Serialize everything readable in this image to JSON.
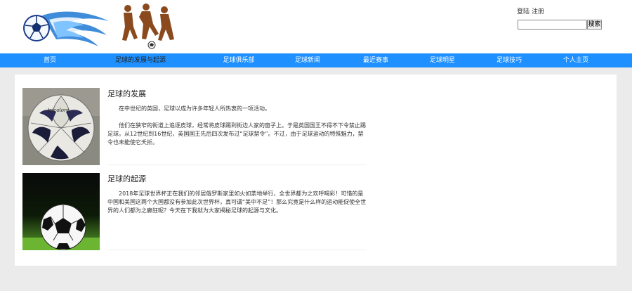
{
  "header": {
    "auth": {
      "login": "登陆",
      "register": "注册"
    },
    "search": {
      "placeholder": "",
      "button": "搜索"
    }
  },
  "nav": {
    "items": [
      {
        "label": "首页"
      },
      {
        "label": "足球的发展与起源"
      },
      {
        "label": "足球俱乐部"
      },
      {
        "label": "足球新闻"
      },
      {
        "label": "最近赛事"
      },
      {
        "label": "足球明星"
      },
      {
        "label": "足球技巧"
      },
      {
        "label": "个人主页"
      }
    ],
    "active_index": 1
  },
  "articles": [
    {
      "title": "足球的发展",
      "paragraphs": [
        "在中世纪的英国，足球以成为许多年轻人所热衷的一项活动。",
        "他们在狭窄的街道上追逐皮球，经常将皮球踢到街边人家的窗子上。于是英国国王不得不下令禁止踢足球。从12世纪到16世纪，英国国王先后四次发布过“足球禁令”。不过，由于足球运动的特殊魅力，禁令也未能使它夭折。"
      ]
    },
    {
      "title": "足球的起源",
      "paragraphs": [
        "2018年足球世界杯正在我们的邻居俄罗斯家里如火如荼地举行，全世界都为之欢呼喝彩！可惜的是中国和美国这两个大国都没有参加此次世界杯，真可谓“美中不足”！那么究竟是什么样的运动能促使全世界的人们都为之癫狂呢？今天在下我就为大家揭秘足球的起源与文化。"
      ]
    }
  ],
  "colors": {
    "nav_bg": "#1e90ff",
    "page_bg": "#ebebeb",
    "logo_blue": "#1e6fd8"
  }
}
